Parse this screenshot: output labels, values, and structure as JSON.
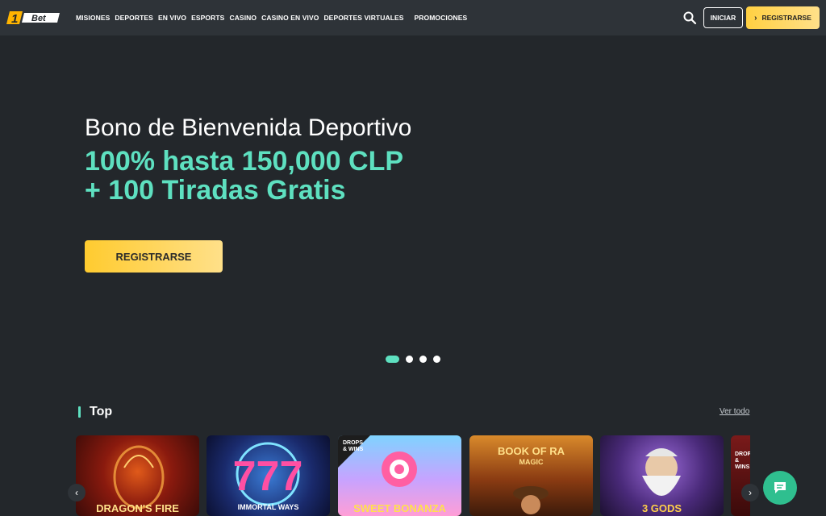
{
  "brand": {
    "logo_text": "Bet",
    "logo_number": "1"
  },
  "nav": {
    "items": [
      "MISIONES",
      "DEPORTES",
      "EN VIVO",
      "ESPORTS",
      "CASINO",
      "CASINO EN VIVO",
      "DEPORTES VIRTUALES",
      "PROMOCIONES"
    ]
  },
  "header": {
    "login_label": "INICIAR",
    "register_label": "REGISTRARSE"
  },
  "hero": {
    "title": "Bono de Bienvenida Deportivo",
    "offer_line1": "100% hasta 150,000 CLP",
    "offer_line2": "+ 100 Tiradas Gratis",
    "cta_label": "REGISTRARSE",
    "slides_total": 4,
    "active_slide": 1
  },
  "section": {
    "title": "Top",
    "see_all": "Ver todo"
  },
  "games": [
    {
      "title": "DRAGON'S FIRE"
    },
    {
      "title": "IMMORTAL WAYS"
    },
    {
      "title": "SWEET BONANZA",
      "badge": "DROPS & WINS"
    },
    {
      "title": "BOOK OF RA",
      "subtitle": "MAGIC"
    },
    {
      "title": "3 GODS"
    },
    {
      "title": "",
      "badge": "DROPS & WINS"
    }
  ],
  "colors": {
    "accent": "#5ee0c0",
    "cta": "#ffcb2f",
    "bg": "#23272b",
    "topbar": "#2e3338"
  }
}
